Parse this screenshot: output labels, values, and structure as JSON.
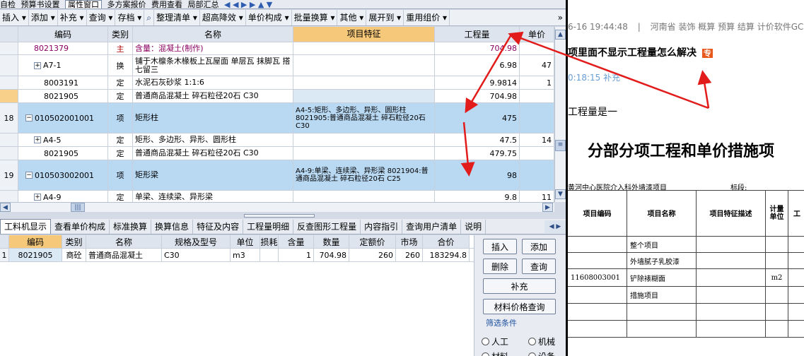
{
  "top_toolbar": {
    "items": [
      "自检",
      "预算书设置",
      "属性窗口",
      "多方案报价",
      "费用查看",
      "局部汇总"
    ]
  },
  "menubar": {
    "items": [
      "插入",
      "添加",
      "补充",
      "查询",
      "存档",
      "整理清单",
      "超高降效",
      "单价构成",
      "批量换算",
      "其他",
      "展开到",
      "重用组价"
    ],
    "overflow": "»"
  },
  "grid": {
    "headers": [
      "编码",
      "类别",
      "名称",
      "项目特征",
      "工程量",
      "单价"
    ],
    "rows": [
      {
        "num": "",
        "code": "8021379",
        "type": "主",
        "name": "含量：混凝土(制作)",
        "feature": "",
        "qty": "704.98",
        "price": ""
      },
      {
        "num": "",
        "code": "A7-1",
        "type": "换",
        "name": "铺于木檩条木椽板上瓦屋面 单层瓦 抹脚瓦 搭七留三",
        "feature": "",
        "qty": "6.98",
        "price": "47"
      },
      {
        "num": "",
        "code": "8003191",
        "type": "定",
        "name": "水泥石灰砂浆 1:1:6",
        "feature": "",
        "qty": "9.9814",
        "price": "1"
      },
      {
        "num": "",
        "code": "8021905",
        "type": "定",
        "name": "普通商品混凝土 碎石粒径20石 C30",
        "feature": "",
        "qty": "704.98",
        "price": ""
      },
      {
        "num": "18",
        "code": "010502001001",
        "type": "项",
        "name": "矩形柱",
        "feature": "A4-5:矩形、多边形、异形、圆形柱 8021905:普通商品混凝土 碎石粒径20石 C30",
        "qty": "475",
        "price": ""
      },
      {
        "num": "",
        "code": "A4-5",
        "type": "定",
        "name": "矩形、多边形、异形、圆形柱",
        "feature": "",
        "qty": "47.5",
        "price": "14"
      },
      {
        "num": "",
        "code": "8021905",
        "type": "定",
        "name": "普通商品混凝土 碎石粒径20石 C30",
        "feature": "",
        "qty": "479.75",
        "price": ""
      },
      {
        "num": "19",
        "code": "010503002001",
        "type": "项",
        "name": "矩形梁",
        "feature": "A4-9:单梁、连续梁、异形梁 8021904:普通商品混凝土 碎石粒径20石 C25",
        "qty": "98",
        "price": ""
      },
      {
        "num": "",
        "code": "A4-9",
        "type": "定",
        "name": "单梁、连续梁、异形梁",
        "feature": "",
        "qty": "9.8",
        "price": "11"
      }
    ]
  },
  "bottom_tabs": [
    "工料机显示",
    "查看单价构成",
    "标准换算",
    "换算信息",
    "特征及内容",
    "工程量明细",
    "反查图形工程量",
    "内容指引",
    "查询用户清单",
    "说明"
  ],
  "material_grid": {
    "headers": [
      "编码",
      "类别",
      "名称",
      "规格及型号",
      "单位",
      "损耗",
      "含量",
      "数量",
      "定额价",
      "市场",
      "合价"
    ],
    "rows": [
      {
        "num": "1",
        "code": "8021905",
        "type": "商砼",
        "name": "普通商品混凝土",
        "spec": "C30",
        "unit": "m3",
        "loss": "",
        "content": "1",
        "qty": "704.98",
        "quota_price": "260",
        "market": "260",
        "total": "183294.8"
      }
    ]
  },
  "side_buttons": {
    "insert": "插入",
    "add": "添加",
    "delete": "删除",
    "query": "查询",
    "supplement": "补充",
    "price_query": "材料价格查询",
    "filter_title": "筛选条件",
    "radios": [
      "人工",
      "机械",
      "材料",
      "设备"
    ]
  },
  "right_panel": {
    "meta_time": "6-16 19:44:48",
    "meta_sep": "|",
    "meta_tags": "河南省  装饰  概算  预算  结算  计价软件GC",
    "question_title": "项里面不显示工程量怎么解决",
    "badge": "专",
    "answer_time": "0:18:15 补充",
    "answer_text": "工程量是一",
    "doc_title": "分部分项工程和单价措施项",
    "doc_project": "黄河中心医院介入科外墙漆项目",
    "doc_section": "标段:",
    "doc_headers": [
      "项目编码",
      "项目名称",
      "项目特征描述",
      "计量单位",
      "工"
    ],
    "doc_rows": [
      {
        "code": "",
        "name": "整个项目",
        "desc": "",
        "unit": ""
      },
      {
        "code": "",
        "name": "外墙腻子乳胶漆",
        "desc": "",
        "unit": ""
      },
      {
        "code": "11608003001",
        "name": "铲除裱糊面",
        "desc": "",
        "unit": "m2"
      },
      {
        "code": "",
        "name": "措施项目",
        "desc": "",
        "unit": ""
      },
      {
        "code": "",
        "name": "",
        "desc": "",
        "unit": ""
      },
      {
        "code": "",
        "name": "",
        "desc": "",
        "unit": ""
      }
    ]
  },
  "colors": {
    "arrow": "#e21b1b",
    "selected_row": "#b9d9f3",
    "feature_header": "#f6c97a",
    "badge": "#e8581c"
  },
  "icons": [
    "search-icon",
    "navigation-arrows-icon",
    "scroll-up-icon",
    "scroll-down-icon",
    "scroll-left-icon",
    "scroll-right-icon",
    "expand-icon",
    "collapse-icon"
  ]
}
